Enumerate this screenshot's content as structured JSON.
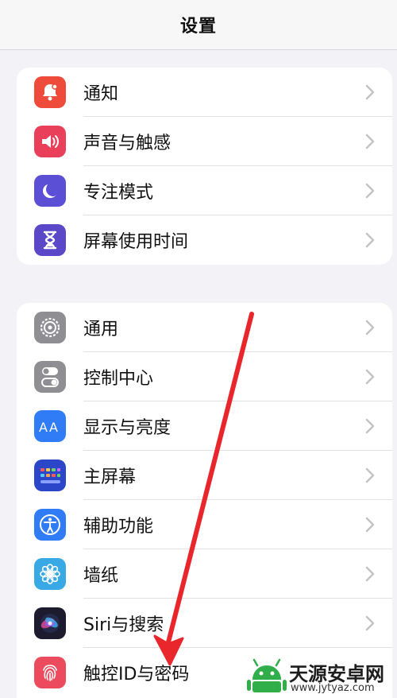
{
  "header": {
    "title": "设置"
  },
  "group1": [
    {
      "label": "通知",
      "icon": "bell-icon",
      "color": "#ee4b3a"
    },
    {
      "label": "声音与触感",
      "icon": "speaker-icon",
      "color": "#ea3f5a"
    },
    {
      "label": "专注模式",
      "icon": "moon-icon",
      "color": "#5b4fd6"
    },
    {
      "label": "屏幕使用时间",
      "icon": "hourglass-icon",
      "color": "#5a48c8"
    }
  ],
  "group2": [
    {
      "label": "通用",
      "icon": "gear-icon",
      "color": "#8e8e93"
    },
    {
      "label": "控制中心",
      "icon": "toggles-icon",
      "color": "#8e8e93"
    },
    {
      "label": "显示与亮度",
      "icon": "text-size-icon",
      "color": "#2f7cf6"
    },
    {
      "label": "主屏幕",
      "icon": "grid-icon",
      "color": "#2b46c9"
    },
    {
      "label": "辅助功能",
      "icon": "accessibility-icon",
      "color": "#2f7cf6"
    },
    {
      "label": "墙纸",
      "icon": "flower-icon",
      "color": "#38a9e4"
    },
    {
      "label": "Siri与搜索",
      "icon": "siri-icon",
      "color": "#1c1c2e"
    },
    {
      "label": "触控ID与密码",
      "icon": "fingerprint-icon",
      "color": "#ec4a5d"
    }
  ],
  "annotation": {
    "arrow_color": "#e8262b"
  },
  "watermark": {
    "name": "天源安卓网",
    "url": "www.jytyaz.com"
  }
}
